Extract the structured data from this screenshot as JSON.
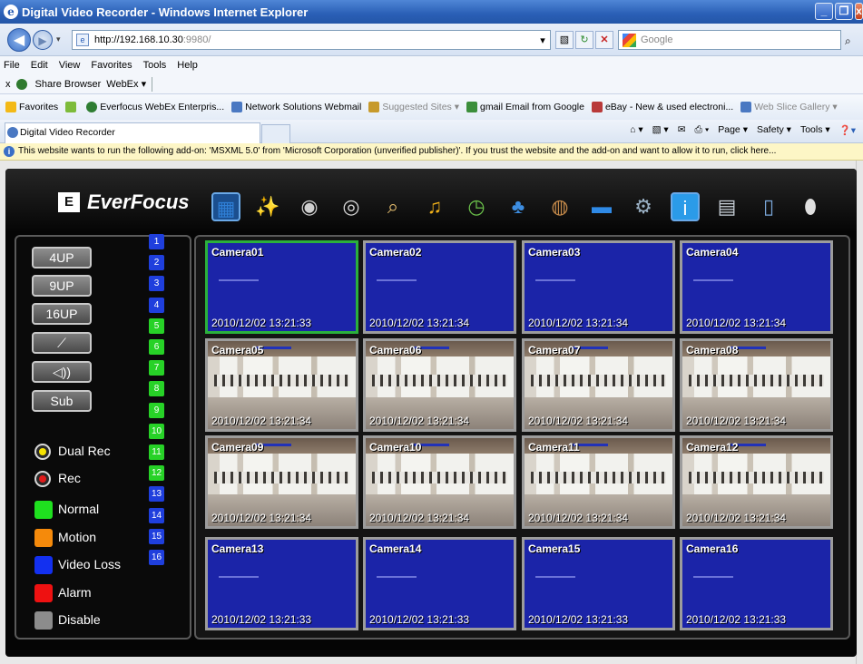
{
  "browser": {
    "window_title": "Digital Video Recorder - Windows Internet Explorer",
    "url_host": "http://192.168.10.30",
    "url_port": ":9980/",
    "search_placeholder": "Google",
    "menu": [
      "File",
      "Edit",
      "View",
      "Favorites",
      "Tools",
      "Help"
    ],
    "links_bar": {
      "close": "x",
      "share": "Share Browser",
      "webex": "WebEx ▾"
    },
    "favorites_label": "Favorites",
    "favorites": [
      {
        "label": "Everfocus WebEx Enterpris...",
        "dim": false,
        "color": "#2e7d32"
      },
      {
        "label": "Network Solutions Webmail",
        "dim": false,
        "color": "#4a78c2"
      },
      {
        "label": "Suggested Sites ▾",
        "dim": true,
        "color": "#c79a2b"
      },
      {
        "label": "gmail Email from Google",
        "dim": false,
        "color": "#3b8e3b"
      },
      {
        "label": "eBay - New & used electroni...",
        "dim": false,
        "color": "#b93a3a"
      },
      {
        "label": "Web Slice Gallery ▾",
        "dim": true,
        "color": "#4a78c2"
      }
    ],
    "tab_title": "Digital Video Recorder",
    "commands": [
      "Page ▾",
      "Safety ▾",
      "Tools ▾"
    ],
    "info_bar": "This website wants to run the following add-on: 'MSXML 5.0' from 'Microsoft Corporation (unverified publisher)'. If you trust the website and the add-on and want to allow it to run, click here..."
  },
  "dvr": {
    "brand": "EverFocus",
    "brand_mark": "E",
    "toolbar_icons": [
      {
        "name": "live-view-icon",
        "glyph": "▦",
        "color": "#2f7fd6",
        "bg": "#1b4f8f"
      },
      {
        "name": "wizard-icon",
        "glyph": "✨",
        "color": "#e8e8e8",
        "bg": "transparent"
      },
      {
        "name": "camera-icon",
        "glyph": "◉",
        "color": "#cfcfcf",
        "bg": "transparent"
      },
      {
        "name": "playback-icon",
        "glyph": "◎",
        "color": "#d8d8d8",
        "bg": "transparent"
      },
      {
        "name": "search-icon",
        "glyph": "⌕",
        "color": "#e8c070",
        "bg": "transparent"
      },
      {
        "name": "alarm-bell-icon",
        "glyph": "♫",
        "color": "#f2b21a",
        "bg": "transparent"
      },
      {
        "name": "schedule-icon",
        "glyph": "◷",
        "color": "#6ac04a",
        "bg": "transparent"
      },
      {
        "name": "network-icon",
        "glyph": "♣",
        "color": "#3d8de0",
        "bg": "transparent"
      },
      {
        "name": "disk-icon",
        "glyph": "◍",
        "color": "#c58a4a",
        "bg": "transparent"
      },
      {
        "name": "display-icon",
        "glyph": "▬",
        "color": "#2f8ae6",
        "bg": "transparent"
      },
      {
        "name": "settings-icon",
        "glyph": "⚙",
        "color": "#9ab0c4",
        "bg": "transparent"
      },
      {
        "name": "info-icon",
        "glyph": "i",
        "color": "#ffffff",
        "bg": "#2b9be8"
      },
      {
        "name": "filmstrip-icon",
        "glyph": "▤",
        "color": "#c8d0d8",
        "bg": "transparent"
      },
      {
        "name": "log-search-icon",
        "glyph": "▯",
        "color": "#7aa6d8",
        "bg": "transparent"
      },
      {
        "name": "logout-icon",
        "glyph": "⬮",
        "color": "#e0e0e0",
        "bg": "transparent"
      }
    ],
    "side_buttons": [
      "4UP",
      "9UP",
      "16UP",
      "🎤",
      "🔈))",
      "Sub"
    ],
    "channel_numbers": [
      "1",
      "2",
      "3",
      "4",
      "5",
      "6",
      "7",
      "8",
      "9",
      "10",
      "11",
      "12",
      "13",
      "14",
      "15",
      "16"
    ],
    "channel_colors": [
      "#1f3fdd",
      "#1f3fdd",
      "#1f3fdd",
      "#1f3fdd",
      "#27d227",
      "#27d227",
      "#27d227",
      "#27d227",
      "#27d227",
      "#27d227",
      "#27d227",
      "#27d227",
      "#1f3fdd",
      "#1f3fdd",
      "#1f3fdd",
      "#1f3fdd"
    ],
    "rec_indicators": [
      {
        "label": "Dual Rec",
        "color": "#f5e200"
      },
      {
        "label": "Rec",
        "color": "#e01b1b"
      }
    ],
    "legend": [
      {
        "label": "Normal",
        "color": "#1fe01f"
      },
      {
        "label": "Motion",
        "color": "#f58a0b"
      },
      {
        "label": "Video Loss",
        "color": "#1330f0"
      },
      {
        "label": "Alarm",
        "color": "#ee1111"
      },
      {
        "label": "Disable",
        "color": "#8c8c8c"
      }
    ],
    "cameras": [
      {
        "name": "Camera01",
        "timestamp": "2010/12/02  13:21:33",
        "feed": "video-loss",
        "selected": true
      },
      {
        "name": "Camera02",
        "timestamp": "2010/12/02  13:21:34",
        "feed": "video-loss",
        "selected": false
      },
      {
        "name": "Camera03",
        "timestamp": "2010/12/02  13:21:34",
        "feed": "video-loss",
        "selected": false
      },
      {
        "name": "Camera04",
        "timestamp": "2010/12/02  13:21:34",
        "feed": "video-loss",
        "selected": false
      },
      {
        "name": "Camera05",
        "timestamp": "2010/12/02  13:21:34",
        "feed": "live",
        "selected": false
      },
      {
        "name": "Camera06",
        "timestamp": "2010/12/02  13:21:34",
        "feed": "live",
        "selected": false
      },
      {
        "name": "Camera07",
        "timestamp": "2010/12/02  13:21:34",
        "feed": "live",
        "selected": false
      },
      {
        "name": "Camera08",
        "timestamp": "2010/12/02  13:21:34",
        "feed": "live",
        "selected": false
      },
      {
        "name": "Camera09",
        "timestamp": "2010/12/02  13:21:34",
        "feed": "live",
        "selected": false
      },
      {
        "name": "Camera10",
        "timestamp": "2010/12/02  13:21:34",
        "feed": "live",
        "selected": false
      },
      {
        "name": "Camera11",
        "timestamp": "2010/12/02  13:21:34",
        "feed": "live",
        "selected": false
      },
      {
        "name": "Camera12",
        "timestamp": "2010/12/02  13:21:34",
        "feed": "live",
        "selected": false
      },
      {
        "name": "Camera13",
        "timestamp": "2010/12/02  13:21:33",
        "feed": "video-loss",
        "selected": false
      },
      {
        "name": "Camera14",
        "timestamp": "2010/12/02  13:21:33",
        "feed": "video-loss",
        "selected": false
      },
      {
        "name": "Camera15",
        "timestamp": "2010/12/02  13:21:33",
        "feed": "video-loss",
        "selected": false
      },
      {
        "name": "Camera16",
        "timestamp": "2010/12/02  13:21:33",
        "feed": "video-loss",
        "selected": false
      }
    ]
  }
}
